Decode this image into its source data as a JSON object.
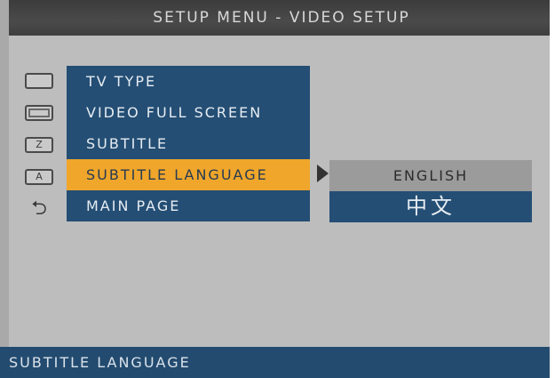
{
  "title_bar": {
    "text": "SETUP MENU - VIDEO SETUP"
  },
  "icons": [
    {
      "name": "tv-type-icon",
      "glyph": ""
    },
    {
      "name": "full-screen-icon",
      "glyph": ""
    },
    {
      "name": "subtitle-icon",
      "glyph": "Z"
    },
    {
      "name": "subtitle-language-icon",
      "glyph": "A"
    },
    {
      "name": "return-icon",
      "glyph": "⮌"
    }
  ],
  "menu": {
    "items": [
      {
        "label": "TV TYPE"
      },
      {
        "label": "VIDEO FULL SCREEN"
      },
      {
        "label": "SUBTITLE"
      },
      {
        "label": "SUBTITLE LANGUAGE",
        "selected": true
      },
      {
        "label": "MAIN PAGE"
      }
    ]
  },
  "submenu": {
    "items": [
      {
        "label": "ENGLISH",
        "selected": true
      },
      {
        "label": "中文"
      }
    ]
  },
  "status_bar": {
    "text": "SUBTITLE LANGUAGE"
  },
  "colors": {
    "menu_bg": "#244e74",
    "selected_bg": "#f0a62a",
    "submenu_selected_bg": "#9b9b9b",
    "screen_bg": "#bdbdbd"
  }
}
